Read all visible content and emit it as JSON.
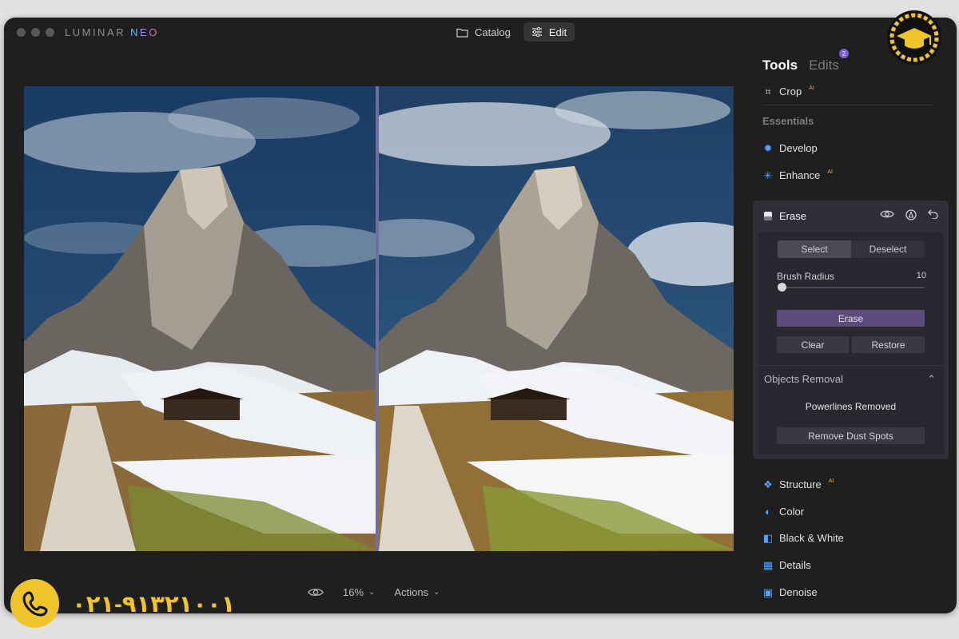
{
  "app": {
    "brand_prefix": "LUMINAR",
    "brand_suffix": "NEO",
    "modes": {
      "catalog": "Catalog",
      "edit": "Edit"
    }
  },
  "bottom_bar": {
    "zoom": "16%",
    "actions": "Actions"
  },
  "panel": {
    "tabs": {
      "tools": "Tools",
      "edits": "Edits",
      "edits_badge": "2"
    },
    "ai_tag": "AI",
    "crop": "Crop",
    "section_essentials": "Essentials",
    "develop": "Develop",
    "enhance": "Enhance",
    "erase": {
      "title": "Erase",
      "select": "Select",
      "deselect": "Deselect",
      "brush_label": "Brush Radius",
      "brush_value": "10",
      "brush_fraction": 0.0,
      "erase_button": "Erase",
      "clear_button": "Clear",
      "restore_button": "Restore",
      "objects_removal": "Objects Removal",
      "objects_status": "Powerlines Removed",
      "dust_button": "Remove Dust Spots"
    },
    "structure": "Structure",
    "color": "Color",
    "black_white": "Black & White",
    "details": "Details",
    "denoise": "Denoise"
  },
  "overlay": {
    "phone": "۰۲۱-۹۱۳۲۱۰۰۱"
  },
  "colors": {
    "accent": "#7b5cd6",
    "erase_button": "#5c4c7c",
    "phone_yellow": "#f0c42b"
  }
}
